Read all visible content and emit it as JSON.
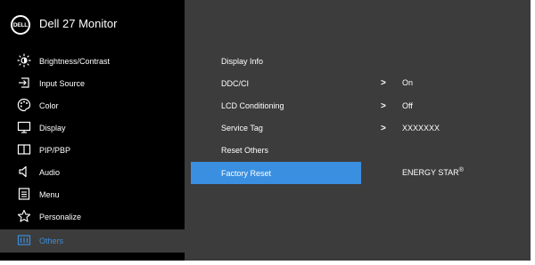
{
  "header": {
    "logo_text": "DELL",
    "title": "Dell 27 Monitor"
  },
  "sidebar": {
    "items": [
      {
        "label": "Brightness/Contrast",
        "icon": "brightness-icon"
      },
      {
        "label": "Input Source",
        "icon": "input-source-icon"
      },
      {
        "label": "Color",
        "icon": "color-palette-icon"
      },
      {
        "label": "Display",
        "icon": "display-icon"
      },
      {
        "label": "PIP/PBP",
        "icon": "pip-pbp-icon"
      },
      {
        "label": "Audio",
        "icon": "speaker-icon"
      },
      {
        "label": "Menu",
        "icon": "menu-icon"
      },
      {
        "label": "Personalize",
        "icon": "star-icon"
      },
      {
        "label": "Others",
        "icon": "others-icon",
        "selected": true
      }
    ]
  },
  "options": {
    "items": [
      {
        "label": "Display Info"
      },
      {
        "label": "DDC/CI",
        "value": "On"
      },
      {
        "label": "LCD Conditioning",
        "value": "Off"
      },
      {
        "label": "Service Tag",
        "value": "XXXXXXX"
      },
      {
        "label": "Reset Others"
      },
      {
        "label": "Factory Reset",
        "selected": true
      }
    ],
    "chevron": ">",
    "energy_star": "ENERGY STAR",
    "energy_star_mark": "®"
  },
  "colors": {
    "accent": "#3a8fe0",
    "panel": "#3c3c3c",
    "sidebar": "#000000"
  }
}
